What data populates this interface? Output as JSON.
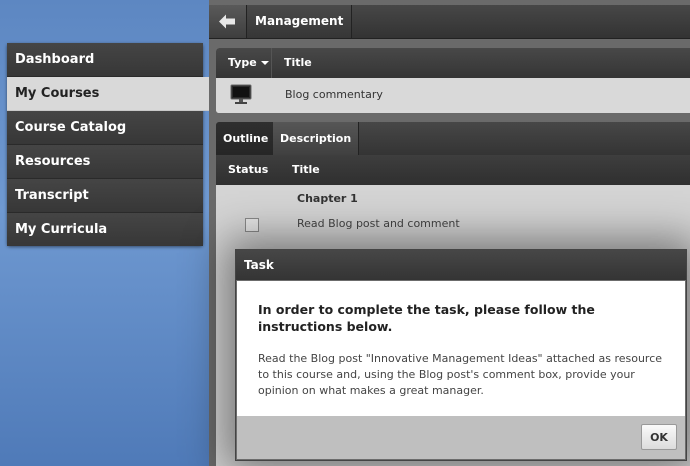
{
  "sidebar": {
    "items": [
      {
        "label": "Dashboard",
        "active": false
      },
      {
        "label": "My Courses",
        "active": true
      },
      {
        "label": "Course Catalog",
        "active": false
      },
      {
        "label": "Resources",
        "active": false
      },
      {
        "label": "Transcript",
        "active": false
      },
      {
        "label": "My Curricula",
        "active": false
      }
    ]
  },
  "topbar": {
    "back_icon": "arrow-left-icon",
    "breadcrumb": "Management"
  },
  "course_table": {
    "columns": [
      "Type",
      "Title"
    ],
    "rows": [
      {
        "type_icon": "monitor-icon",
        "title": "Blog commentary"
      }
    ]
  },
  "outline": {
    "tabs": [
      {
        "label": "Outline",
        "active": true
      },
      {
        "label": "Description",
        "active": false
      }
    ],
    "columns": [
      "Status",
      "Title"
    ],
    "chapter": "Chapter 1",
    "items": [
      {
        "status": "unchecked",
        "title": "Read Blog post and comment"
      }
    ]
  },
  "dialog": {
    "title": "Task",
    "heading": "In order to complete the task, please follow the instructions below.",
    "text": "Read the Blog post \"Innovative Management Ideas\" attached as resource to this course and, using the Blog post's comment box, provide your opinion on what makes a great manager.",
    "ok_label": "OK"
  }
}
